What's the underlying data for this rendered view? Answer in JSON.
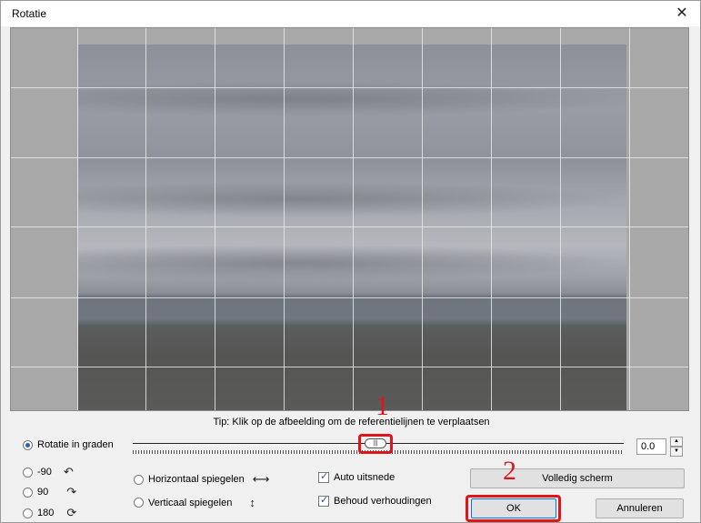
{
  "window": {
    "title": "Rotatie"
  },
  "tip": "Tip: Klik op de afbeelding om de referentielijnen te verplaatsen",
  "rotation": {
    "label": "Rotatie in graden",
    "value": "0.0"
  },
  "presets": [
    {
      "label": "-90",
      "icon": "rotate-left-icon"
    },
    {
      "label": "90",
      "icon": "rotate-right-icon"
    },
    {
      "label": "180",
      "icon": "rotate-180-icon"
    }
  ],
  "mirror": {
    "horizontal": "Horizontaal spiegelen",
    "vertical": "Verticaal spiegelen"
  },
  "options": {
    "auto_crop": {
      "label": "Auto uitsnede",
      "checked": true
    },
    "keep_ratio": {
      "label": "Behoud verhoudingen",
      "checked": true
    }
  },
  "buttons": {
    "fullscreen": "Volledig scherm",
    "ok": "OK",
    "cancel": "Annuleren"
  },
  "annotations": {
    "one": "1",
    "two": "2"
  },
  "colors": {
    "highlight": "#e0141b",
    "accent": "#0078d7"
  }
}
